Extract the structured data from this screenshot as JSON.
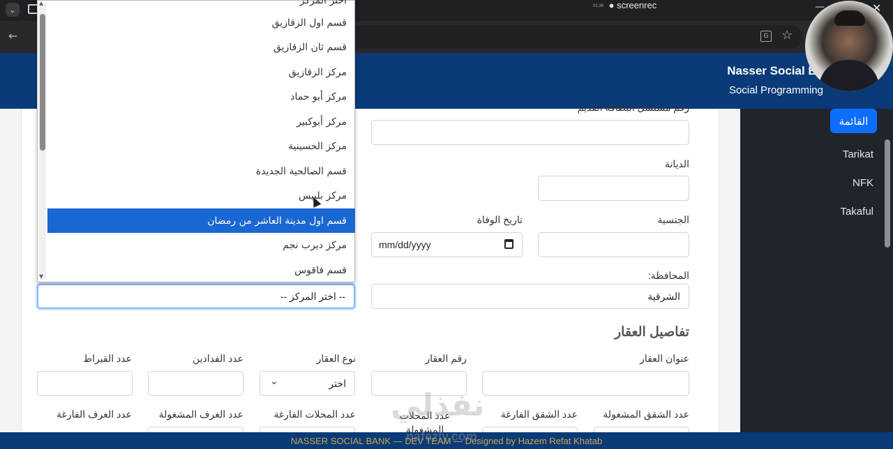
{
  "recording": {
    "time": "01:39",
    "label": "screenrec"
  },
  "header": {
    "brand": "Nasser Social Bank",
    "subtitle": "Social Programming"
  },
  "sidebar": {
    "active": "القائمة",
    "items": [
      "Tarikat",
      "NFK",
      "Takaful"
    ]
  },
  "form": {
    "labels": {
      "old_id": "رقم مسلسل البطاقة القديم",
      "religion": "الديانة",
      "nationality": "الجنسية",
      "death_date": "تاريخ الوفاة",
      "governorate": "المحافظة:",
      "property_address": "عنوان العقار",
      "property_no": "رقم العقار",
      "property_type": "نوع العقار",
      "feddans": "عدد الفدادين",
      "qirats": "عدد القيراط",
      "occupied_apts": "عدد الشقق المشغولة",
      "vacant_apts": "عدد الشقق الفارغة",
      "occupied_shops": "عدد المحلات المشغولة",
      "vacant_shops": "عدد المحلات الفارغة",
      "occupied_rooms": "عدد الغرف المشغولة",
      "vacant_rooms": "عدد الغرف الفارغة"
    },
    "death_date_placeholder": "mm/dd/yyyy",
    "governorate_value": "الشرقية",
    "center_select_value": "-- اختر المركز --",
    "property_type_value": "اختر",
    "section_title": "تفاصيل العقار"
  },
  "dropdown": {
    "options": [
      "اختر المركز",
      "قسم اول الزقازيق",
      "قسم ثان الزقازيق",
      "مركز الزقازيق",
      "مركز أبو حماد",
      "مركز أبوكبير",
      "مركز الحسينية",
      "قسم الصالحية الجديدة",
      "مركز بلبيس",
      "قسم اول مدينة العاشر من رمضان",
      "مركز ديرب نجم",
      "قسم فاقوس"
    ],
    "selected_index": 9
  },
  "footer": {
    "text": "NASSER SOCIAL BANK — DEV TEAM — Designed by Hazem Refat Khatab"
  },
  "watermark": {
    "arabic": "نفذلي",
    "latin": "nafezly.com"
  },
  "colors": {
    "brand_blue": "#0a3a78",
    "accent": "#0d6efd",
    "selection": "#1967d2"
  }
}
